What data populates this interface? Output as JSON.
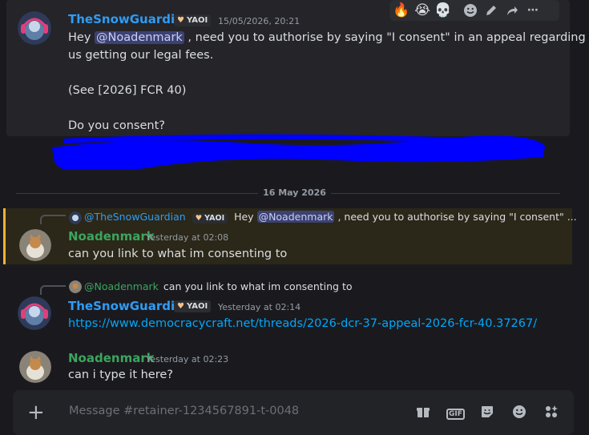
{
  "hover_toolbar": {
    "reactions": [
      "🔥",
      "😭",
      "💀"
    ],
    "icons": [
      "add-reaction-icon",
      "edit-icon",
      "reply-forward-icon",
      "more-icon"
    ]
  },
  "messages": {
    "m1": {
      "author": "TheSnowGuardian",
      "tag": "YAOI",
      "timestamp": "15/05/2026, 20:21",
      "line1_pre": "Hey ",
      "line1_mention": "@Noadenmark",
      "line1_post": " , need you to authorise by saying \"I consent\" in an appeal regarding",
      "line2": "us getting our legal fees.",
      "line3": "(See [2026] FCR 40)",
      "line4": "Do you consent?"
    },
    "date_divider": "16 May 2026",
    "m2": {
      "reply_author": "@TheSnowGuardian",
      "reply_tag": "YAOI",
      "reply_pre": "Hey ",
      "reply_mention": "@Noadenmark",
      "reply_post": " , need you to authorise by saying \"I consent\" ...",
      "author": "Noadenmark",
      "timestamp": "Yesterday at 02:08",
      "text": "can you link to what im consenting to"
    },
    "m3": {
      "reply_author": "@Noadenmark",
      "reply_text": "can you link to what im consenting to",
      "author": "TheSnowGuardian",
      "tag": "YAOI",
      "timestamp": "Yesterday at 02:14",
      "link": "https://www.democracycraft.net/threads/2026-dcr-37-appeal-2026-fcr-40.37267/"
    },
    "m4": {
      "author": "Noadenmark",
      "timestamp": "Yesterday at 02:23",
      "text": "can i type it here?"
    }
  },
  "composer": {
    "placeholder": "Message #retainer-1234567891-t-0048",
    "gif_label": "GIF"
  },
  "colors": {
    "blue_name": "#2f9cf4",
    "green_name": "#3ba55d",
    "link": "#00a8fc",
    "mention_highlight": "#f0b232",
    "redaction": "#0000ff"
  }
}
